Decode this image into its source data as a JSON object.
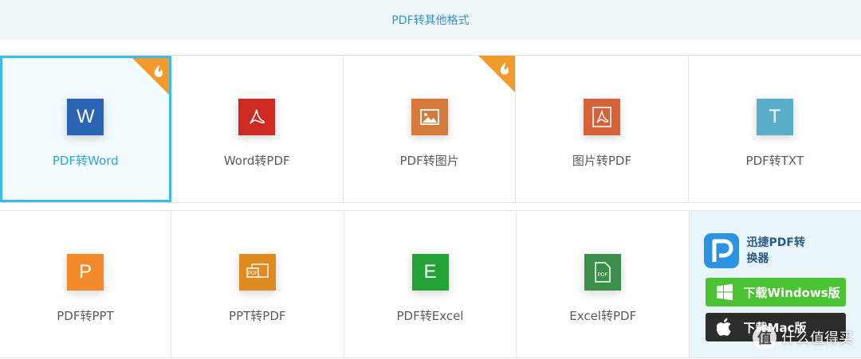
{
  "header": {
    "title": "PDF转其他格式"
  },
  "row1": [
    {
      "label": "PDF转Word",
      "glyph": "W",
      "color": "#2b63b5",
      "icon": "word-icon",
      "hot": true,
      "selected": true
    },
    {
      "label": "Word转PDF",
      "glyph": "",
      "color": "#cc2a22",
      "icon": "acrobat-icon",
      "hot": false,
      "selected": false
    },
    {
      "label": "PDF转图片",
      "glyph": "",
      "color": "#d57a3b",
      "icon": "image-icon",
      "hot": true,
      "selected": false
    },
    {
      "label": "图片转PDF",
      "glyph": "",
      "color": "#d4623b",
      "icon": "acrobat-icon",
      "hot": false,
      "selected": false
    },
    {
      "label": "PDF转TXT",
      "glyph": "T",
      "color": "#5aaec8",
      "icon": "txt-icon",
      "hot": false,
      "selected": false
    }
  ],
  "row2": [
    {
      "label": "PDF转PPT",
      "glyph": "P",
      "color": "#f28a2c",
      "icon": "ppt-icon"
    },
    {
      "label": "PPT转PDF",
      "glyph": "PDF",
      "color": "#e08a22",
      "icon": "pdf-doc-icon"
    },
    {
      "label": "PDF转Excel",
      "glyph": "E",
      "color": "#26a338",
      "icon": "excel-icon"
    },
    {
      "label": "Excel转PDF",
      "glyph": "PDF",
      "color": "#3c8f4a",
      "icon": "pdf-doc-icon"
    }
  ],
  "promo": {
    "app_name": "迅捷PDF转换器",
    "app_icon": "app-logo-icon",
    "windows_label": "下载Windows版",
    "mac_label": "下载Mac版"
  },
  "watermark": {
    "badge": "值",
    "text": "什么值得买"
  },
  "colors": {
    "accent": "#3bbbe6",
    "hot": "#f39a2d"
  }
}
